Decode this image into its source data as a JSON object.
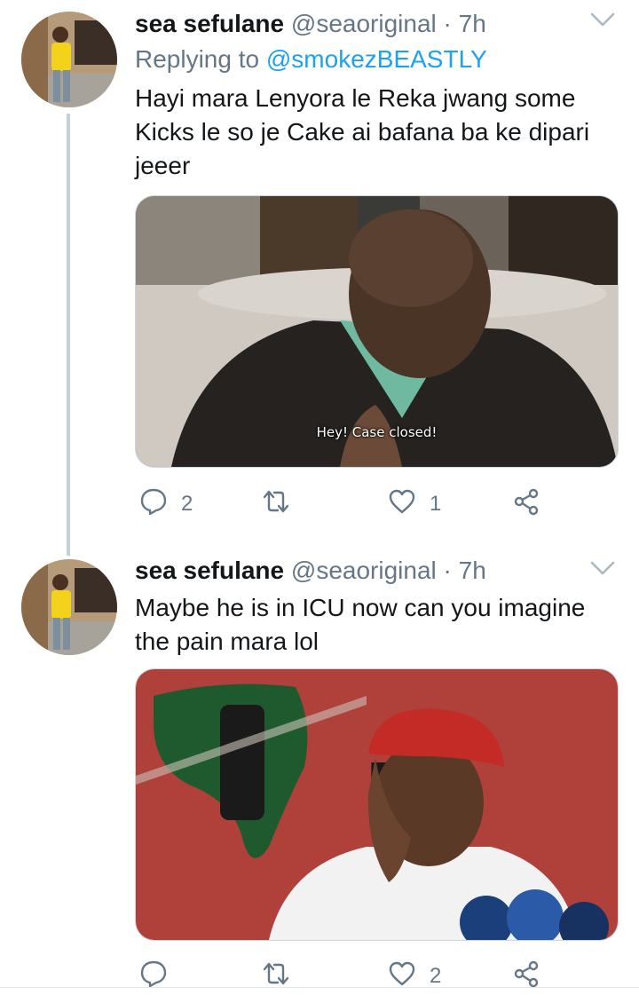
{
  "tweets": [
    {
      "display_name": "sea sefulane",
      "handle": "@seaoriginal",
      "separator": "·",
      "time": "7h",
      "replying_prefix": "Replying to",
      "replying_to": "@smokezBEASTLY",
      "text": "Hayi mara Lenyora le Reka jwang some Kicks le so je Cake ai bafana ba ke dipari jeeer",
      "media_caption": "Hey! Case closed!",
      "reply_count": "2",
      "retweet_count": "",
      "like_count": "1"
    },
    {
      "display_name": "sea sefulane",
      "handle": "@seaoriginal",
      "separator": "·",
      "time": "7h",
      "text": "Maybe he is in ICU now can you imagine the pain mara lol",
      "reply_count": "",
      "retweet_count": "",
      "like_count": "2"
    }
  ],
  "icons": {
    "menu": "chevron-down-icon",
    "reply": "reply-icon",
    "retweet": "retweet-icon",
    "like": "heart-icon",
    "share": "share-icon"
  },
  "colors": {
    "text": "#14171a",
    "secondary": "#657786",
    "link": "#1da1f2",
    "thread_line": "#c4cfd6"
  }
}
